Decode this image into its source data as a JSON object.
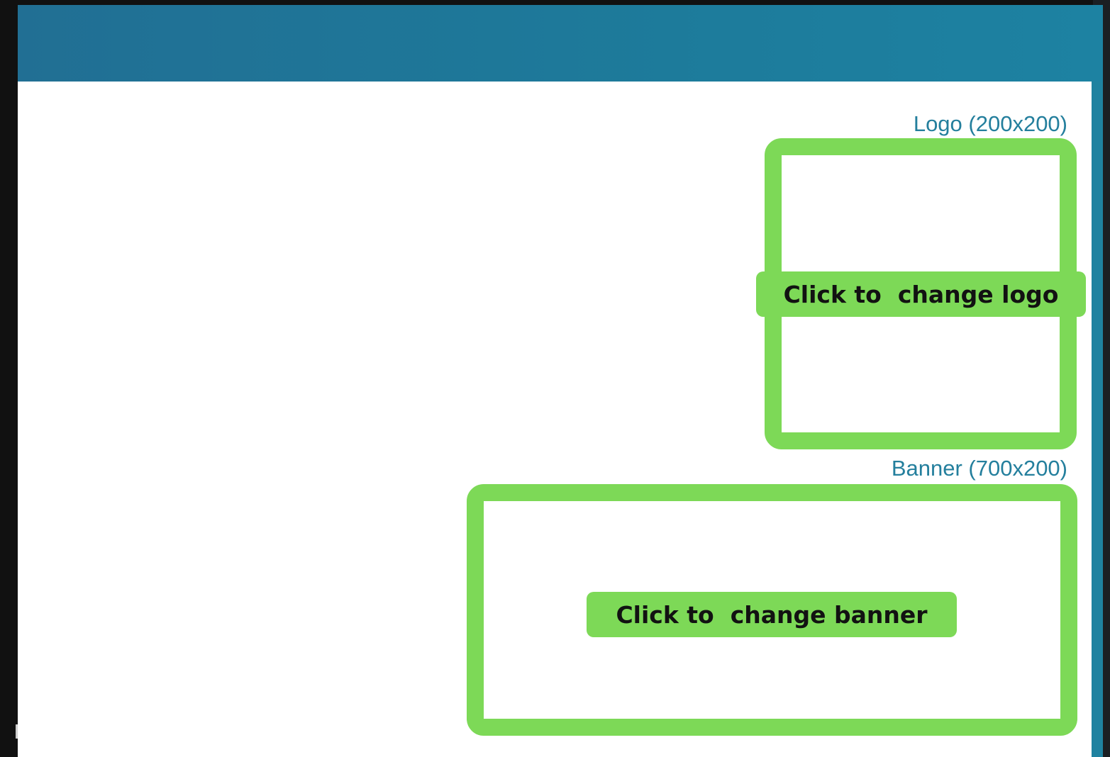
{
  "logo_section": {
    "label": "Logo (200x200)",
    "button_label": "Click to  change logo"
  },
  "banner_section": {
    "label": "Banner (700x200)",
    "button_label": "Click to  change banner"
  },
  "colors": {
    "header": "#1d7b9b",
    "label_text": "#247f9d",
    "upload_accent": "#7dd957",
    "background": "#111111"
  }
}
